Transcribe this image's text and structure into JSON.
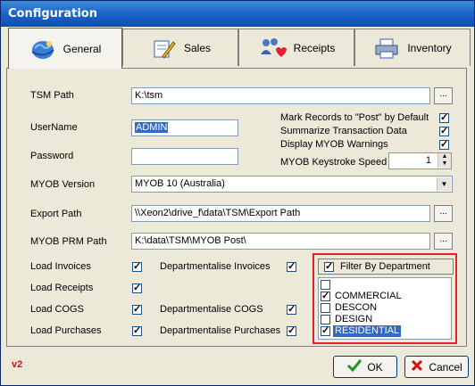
{
  "window": {
    "title": "Configuration"
  },
  "tabs": [
    {
      "label": "General",
      "icon": "globe-icon",
      "active": true
    },
    {
      "label": "Sales",
      "icon": "notepad-pencil-icon",
      "active": false
    },
    {
      "label": "Receipts",
      "icon": "heart-people-icon",
      "active": false
    },
    {
      "label": "Inventory",
      "icon": "printer-icon",
      "active": false
    }
  ],
  "form": {
    "tsm_path": {
      "label": "TSM Path",
      "value": "K:\\tsm",
      "browse": "..."
    },
    "username": {
      "label": "UserName",
      "value": "ADMIN"
    },
    "password": {
      "label": "Password",
      "value": ""
    },
    "myob_version": {
      "label": "MYOB Version",
      "value": "MYOB 10 (Australia)"
    },
    "export_path": {
      "label": "Export Path",
      "value": "\\\\Xeon2\\drive_f\\data\\TSM\\Export Path",
      "browse": "..."
    },
    "prm_path": {
      "label": "MYOB PRM Path",
      "value": "K:\\data\\TSM\\MYOB Post\\",
      "browse": "..."
    }
  },
  "options": {
    "mark_post": {
      "label": "Mark Records to \"Post\" by Default",
      "checked": true
    },
    "summarize": {
      "label": "Summarize Transaction Data",
      "checked": true
    },
    "warnings": {
      "label": "Display MYOB Warnings",
      "checked": true
    },
    "keystroke": {
      "label": "MYOB Keystroke Speed",
      "value": "1"
    }
  },
  "loads": [
    {
      "label": "Load Invoices",
      "checked": true,
      "dept_label": "Departmentalise Invoices",
      "dept_checked": true
    },
    {
      "label": "Load Receipts",
      "checked": true,
      "dept_label": "",
      "dept_checked": null
    },
    {
      "label": "Load COGS",
      "checked": true,
      "dept_label": "Departmentalise COGS",
      "dept_checked": true
    },
    {
      "label": "Load Purchases",
      "checked": true,
      "dept_label": "Departmentalise Purchases",
      "dept_checked": true
    }
  ],
  "filter": {
    "label": "Filter By Department",
    "checked": true,
    "items": [
      {
        "label": "",
        "checked": false,
        "selected": false
      },
      {
        "label": "COMMERCIAL",
        "checked": true,
        "selected": false
      },
      {
        "label": "DESCON",
        "checked": false,
        "selected": false
      },
      {
        "label": "DESIGN",
        "checked": false,
        "selected": false
      },
      {
        "label": "RESIDENTIAL",
        "checked": true,
        "selected": true
      }
    ]
  },
  "footer": {
    "version": "v2",
    "ok_label": "OK",
    "cancel_label": "Cancel"
  },
  "colors": {
    "title_bar": "#1c63c9",
    "highlight": "#316ac5",
    "filter_border": "#e0202a",
    "version": "#d01010"
  }
}
